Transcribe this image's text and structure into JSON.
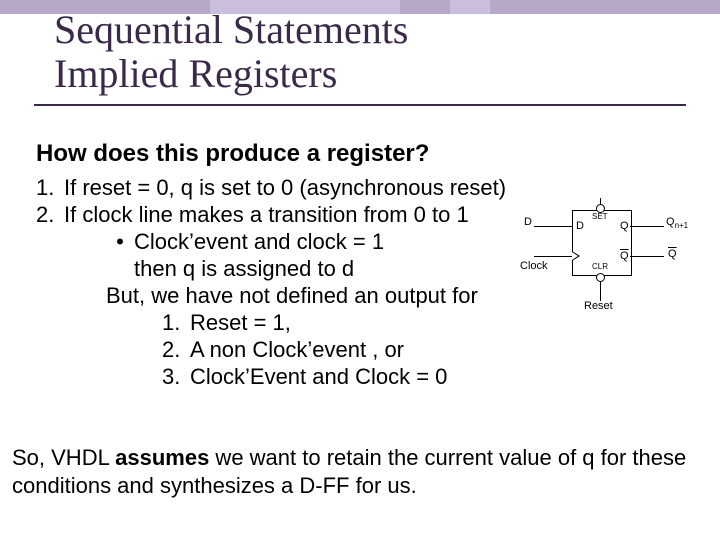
{
  "title_line1": "Sequential Statements",
  "title_line2": "Implied Registers",
  "question": "How does this produce a register?",
  "list": {
    "i1_num": "1.",
    "i1": "If reset = 0,  q is set to 0  (asynchronous reset)",
    "i2_num": "2.",
    "i2": "If clock line makes a transition from 0 to 1",
    "bullet_mark": "•",
    "bullet": "Clock’event and clock = 1",
    "then": "then q is assigned to d",
    "but": "But, we have not defined an output for",
    "s1_num": "1.",
    "s1": "Reset = 1,",
    "s2_num": "2.",
    "s2": "A non Clock’event , or",
    "s3_num": "3.",
    "s3": "Clock’Event and Clock = 0"
  },
  "conclusion_a": "So, VHDL ",
  "conclusion_b_bold": "assumes",
  "conclusion_c": " we want to retain the current value of q for these conditions and synthesizes a D-FF for us.",
  "ff": {
    "d_ext": "D",
    "clock": "Clock",
    "reset": "Reset",
    "d_int": "D",
    "set": "SET",
    "clr": "CLR",
    "q": "Q",
    "qbar": "Q",
    "qnext": "Qn+1"
  }
}
